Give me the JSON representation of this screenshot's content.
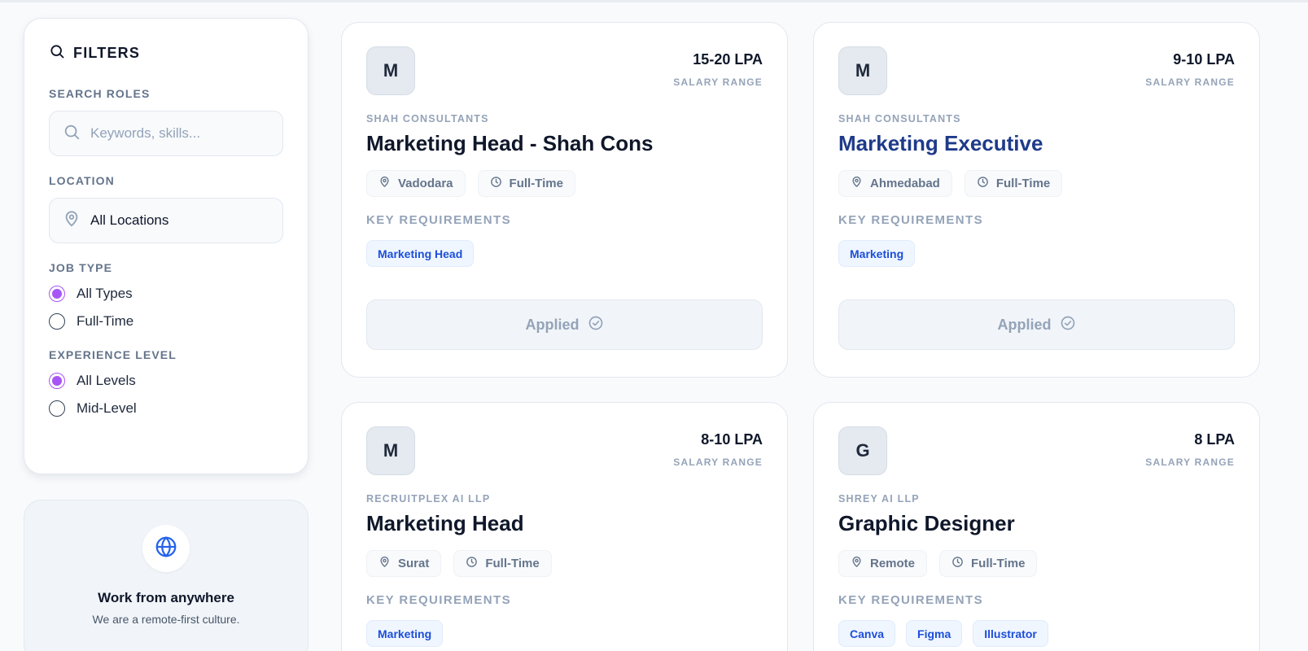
{
  "filters": {
    "title": "FILTERS",
    "search": {
      "label": "SEARCH ROLES",
      "placeholder": "Keywords, skills..."
    },
    "location": {
      "label": "LOCATION",
      "value": "All Locations"
    },
    "job_type": {
      "label": "JOB TYPE",
      "options": [
        {
          "label": "All Types",
          "selected": true
        },
        {
          "label": "Full-Time",
          "selected": false
        }
      ]
    },
    "experience": {
      "label": "EXPERIENCE LEVEL",
      "options": [
        {
          "label": "All Levels",
          "selected": true
        },
        {
          "label": "Mid-Level",
          "selected": false
        }
      ]
    }
  },
  "remote_card": {
    "title": "Work from anywhere",
    "subtitle": "We are a remote-first culture."
  },
  "jobs": [
    {
      "logo_letter": "M",
      "salary": "15-20 LPA",
      "salary_label": "SALARY RANGE",
      "company": "SHAH CONSULTANTS",
      "title": "Marketing Head - Shah Cons",
      "location": "Vadodara",
      "type": "Full-Time",
      "requirements_label": "KEY REQUIREMENTS",
      "skills": [
        "Marketing Head"
      ],
      "action_label": "Applied"
    },
    {
      "logo_letter": "M",
      "salary": "9-10 LPA",
      "salary_label": "SALARY RANGE",
      "company": "SHAH CONSULTANTS",
      "title": "Marketing Executive",
      "location": "Ahmedabad",
      "type": "Full-Time",
      "requirements_label": "KEY REQUIREMENTS",
      "skills": [
        "Marketing"
      ],
      "action_label": "Applied"
    },
    {
      "logo_letter": "M",
      "salary": "8-10 LPA",
      "salary_label": "SALARY RANGE",
      "company": "RECRUITPLEX AI LLP",
      "title": "Marketing Head",
      "location": "Surat",
      "type": "Full-Time",
      "requirements_label": "KEY REQUIREMENTS",
      "skills": [
        "Marketing"
      ]
    },
    {
      "logo_letter": "G",
      "salary": "8 LPA",
      "salary_label": "SALARY RANGE",
      "company": "SHREY AI LLP",
      "title": "Graphic Designer",
      "location": "Remote",
      "type": "Full-Time",
      "requirements_label": "KEY REQUIREMENTS",
      "skills": [
        "Canva",
        "Figma",
        "Illustrator"
      ]
    }
  ],
  "colors": {
    "accent_radio": "#a855f7",
    "skill_text": "#1d4ed8",
    "highlight_title": "#1e3a8a",
    "globe_icon": "#2563eb"
  }
}
